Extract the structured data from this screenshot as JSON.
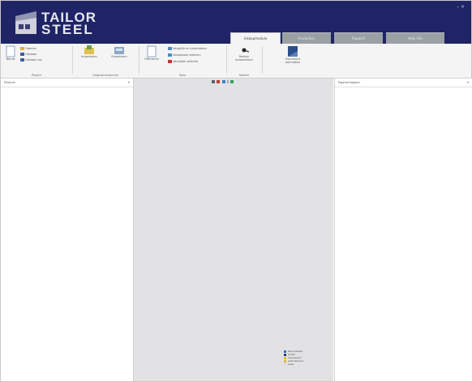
{
  "header": {
    "logo_line1": "TAILOR",
    "logo_line2": "STEEL",
    "window_controls": "–  ×"
  },
  "tabs": [
    {
      "label": "Inkoopmodule",
      "active": true
    },
    {
      "label": "Producten",
      "active": false
    },
    {
      "label": "Rapport",
      "active": false
    },
    {
      "label": "Help Info",
      "active": false
    }
  ],
  "ribbon": {
    "new_label": "Nieuw",
    "open_label": "Openen",
    "save_label": "Opslaan",
    "saveas_label": "Opslaan als",
    "import_label": "Importeren",
    "export_label": "Exporteren",
    "group_project": "Project",
    "group_data": "Gegevensbronnen",
    "offer_label": "Offerteren",
    "menu1": "Vergelijk en controleren",
    "menu2": "Aanpassen tekenen",
    "menu3": "Verwijder selectie",
    "group_edit": "Tools",
    "nest_label": "Nesten automatisch",
    "group_nest": "Nesten",
    "doc_label": "Document aanmaken",
    "group_doc": ""
  },
  "left_panel": {
    "title": "Projects"
  },
  "right_panel": {
    "title": "Eigenschappen"
  },
  "legend": [
    {
      "label": "Beschikbaar",
      "color": "#3a6fb0"
    },
    {
      "label": "Actief",
      "color": "#2b3f7a"
    },
    {
      "label": "Onbewerkt",
      "color": "#e0c020"
    },
    {
      "label": "Geblokkeerd",
      "color": "#e8b040"
    },
    {
      "label": "Klaar",
      "color": "#d8d8d8"
    }
  ]
}
